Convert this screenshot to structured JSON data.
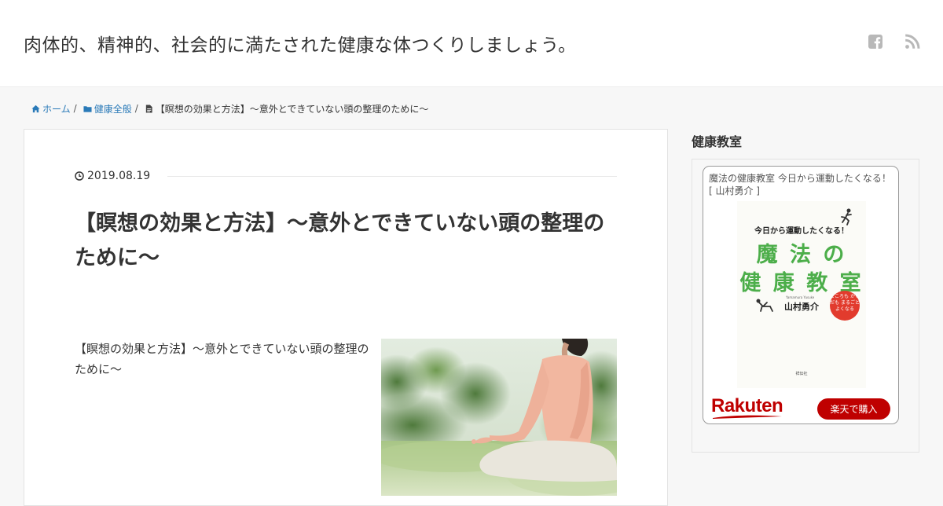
{
  "header": {
    "site_title": "肉体的、精神的、社会的に満たされた健康な体つくりしましょう。",
    "icons": [
      "facebook-icon",
      "rss-icon"
    ]
  },
  "breadcrumb": {
    "home": "ホーム",
    "category": "健康全般",
    "current": "【瞑想の効果と方法】～意外とできていない頭の整理のために～",
    "separator": "/"
  },
  "article": {
    "date": "2019.08.19",
    "title": "【瞑想の効果と方法】～意外とできていない頭の整理のために～",
    "excerpt": "【瞑想の効果と方法】～意外とできていない頭の整理のために～",
    "image": "meditation-photo"
  },
  "sidebar": {
    "widget_title": "健康教室",
    "card": {
      "title": "魔法の健康教室 今日から運動したくなる！ [ 山村勇介 ]",
      "cover": {
        "subtitle": "今日から運動したくなる！",
        "main_line1": "魔 法 の",
        "main_line2": "健 康 教 室",
        "author": "山村勇介",
        "author_en": "Yamamura Yusuke",
        "badge": "こころも からだも まるごと よくなる",
        "publisher": "祥伝社"
      },
      "brand": "Rakuten",
      "buy_label": "楽天で購入"
    }
  },
  "colors": {
    "link": "#2a7ab8",
    "cover_green": "#4cae4a",
    "rakuten_red": "#bf0000",
    "badge_red": "#e23b2d"
  }
}
